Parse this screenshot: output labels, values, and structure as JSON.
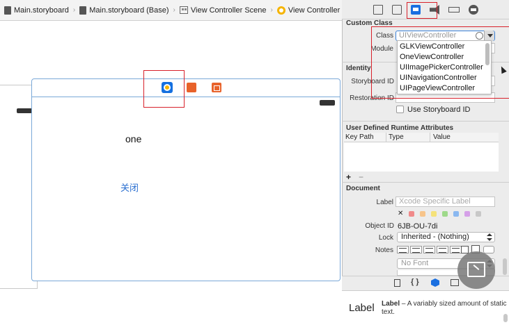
{
  "breadcrumb": {
    "items": [
      "Main.storyboard",
      "Main.storyboard (Base)",
      "View Controller Scene",
      "View Controller"
    ]
  },
  "canvas": {
    "label_text": "one",
    "button_text": "关闭"
  },
  "inspector": {
    "tab_icons": [
      "file-icon",
      "quick-help-icon",
      "identity-icon",
      "attributes-icon",
      "size-icon",
      "connections-icon"
    ],
    "custom_class": {
      "title": "Custom Class",
      "class_label": "Class",
      "class_placeholder": "UIViewController",
      "module_label": "Module",
      "dropdown_options": [
        "GLKViewController",
        "OneViewController",
        "UIImagePickerController",
        "UINavigationController",
        "UIPageViewController"
      ]
    },
    "identity": {
      "title": "Identity",
      "storyboard_id_label": "Storyboard ID",
      "restoration_id_label": "Restoration ID",
      "use_storyboard_id_label": "Use Storyboard ID"
    },
    "runtime_attributes": {
      "title": "User Defined Runtime Attributes",
      "columns": [
        "Key Path",
        "Type",
        "Value"
      ],
      "add": "+",
      "remove": "−"
    },
    "document": {
      "title": "Document",
      "label_label": "Label",
      "label_placeholder": "Xcode Specific Label",
      "clear_glyph": "✕",
      "object_id_label": "Object ID",
      "object_id_value": "6JB-OU-7di",
      "lock_label": "Lock",
      "lock_value": "Inherited - (Nothing)",
      "notes_label": "Notes",
      "font_value": "No Font"
    },
    "library": {
      "tab_glyphs": [
        "{ }"
      ],
      "item_title": "Label",
      "item_icon_text": "Label",
      "item_description": "A variably sized amount of static text."
    }
  },
  "colors": {
    "accent_blue": "#1a6fe0",
    "highlight_red": "#d8202a",
    "vc_yellow": "#f5b400",
    "object_orange": "#e8622a",
    "swatches": [
      "#f08a8a",
      "#f7c48a",
      "#f5e27a",
      "#9ed98a",
      "#8ab8f0",
      "#d5a0e8",
      "#c8c8c8"
    ]
  }
}
